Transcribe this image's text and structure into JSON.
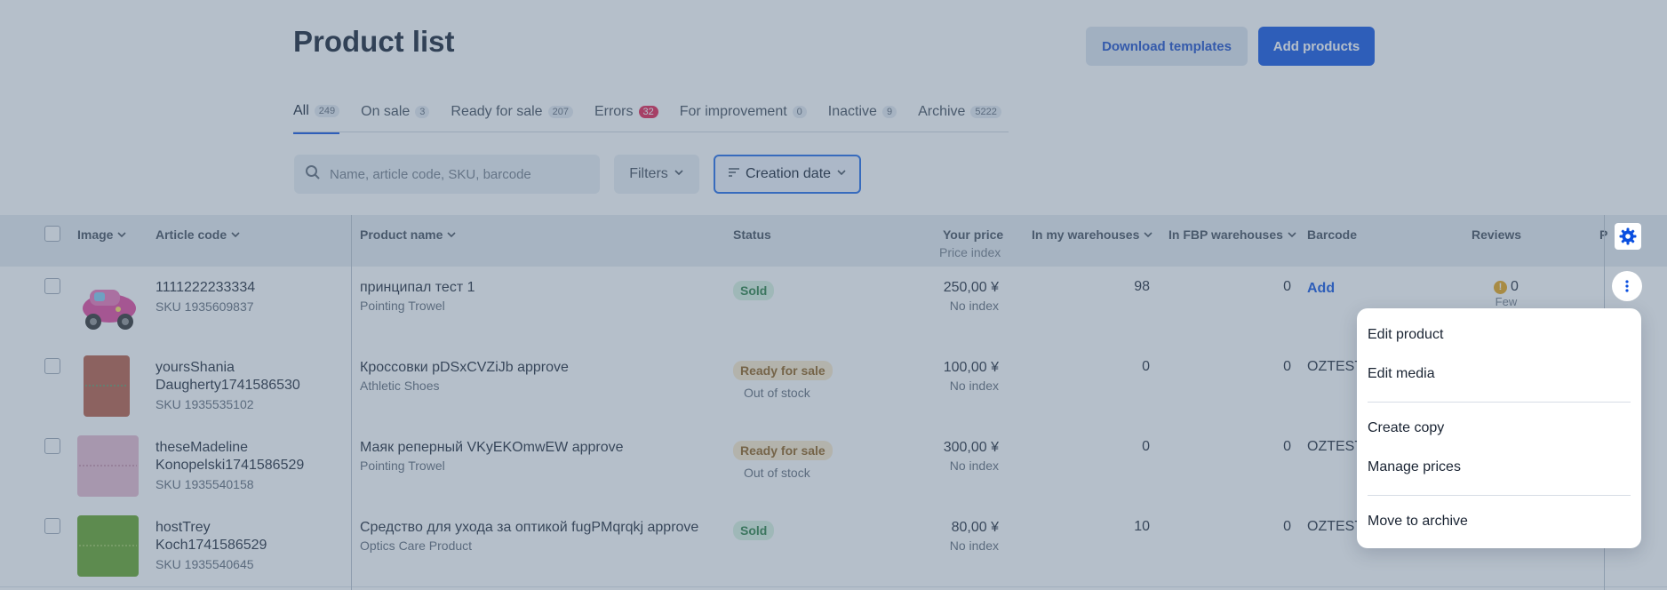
{
  "page": {
    "title": "Product list"
  },
  "buttons": {
    "download_templates": "Download templates",
    "add_products": "Add products"
  },
  "tabs": [
    {
      "label": "All",
      "count": "249"
    },
    {
      "label": "On sale",
      "count": "3"
    },
    {
      "label": "Ready for sale",
      "count": "207"
    },
    {
      "label": "Errors",
      "count": "32"
    },
    {
      "label": "For improvement",
      "count": "0"
    },
    {
      "label": "Inactive",
      "count": "9"
    },
    {
      "label": "Archive",
      "count": "5222"
    }
  ],
  "search": {
    "placeholder": "Name, article code, SKU, barcode",
    "value": ""
  },
  "filters": {
    "label": "Filters"
  },
  "sort": {
    "label": "Creation date"
  },
  "table": {
    "headers": {
      "image": "Image",
      "article_code": "Article code",
      "product_name": "Product name",
      "status": "Status",
      "your_price": "Your price",
      "price_index": "Price index",
      "in_my_warehouses": "In my warehouses",
      "in_fbp_warehouses": "In FBP warehouses",
      "barcode": "Barcode",
      "reviews": "Reviews",
      "cut_off": "P"
    },
    "rows": [
      {
        "article_line1": "1111222233334",
        "article_line2": "",
        "sku": "SKU 1935609837",
        "name": "принципал тест 1",
        "category": "Pointing Trowel",
        "status": "Sold",
        "substatus": "",
        "price": "250,00 ¥",
        "price_index": "No index",
        "my_wh": "98",
        "fbp_wh": "0",
        "barcode": "Add",
        "reviews": "0",
        "reviews_note": "Few"
      },
      {
        "article_line1": "yoursShania",
        "article_line2": "Daugherty1741586530",
        "sku": "SKU 1935535102",
        "name": "Кроссовки pDSxCVZiJb approve",
        "category": "Athletic Shoes",
        "status": "Ready for sale",
        "substatus": "Out of stock",
        "price": "100,00 ¥",
        "price_index": "No index",
        "my_wh": "0",
        "fbp_wh": "0",
        "barcode": "OZTEST"
      },
      {
        "article_line1": "theseMadeline",
        "article_line2": "Konopelski1741586529",
        "sku": "SKU 1935540158",
        "name": "Маяк реперный VKyEKOmwEW approve",
        "category": "Pointing Trowel",
        "status": "Ready for sale",
        "substatus": "Out of stock",
        "price": "300,00 ¥",
        "price_index": "No index",
        "my_wh": "0",
        "fbp_wh": "0",
        "barcode": "OZTEST"
      },
      {
        "article_line1": "hostTrey",
        "article_line2": "Koch1741586529",
        "sku": "SKU 1935540645",
        "name": "Средство для ухода за оптикой fugPMqrqkj approve",
        "category": "Optics Care Product",
        "status": "Sold",
        "substatus": "",
        "price": "80,00 ¥",
        "price_index": "No index",
        "my_wh": "10",
        "fbp_wh": "0",
        "barcode": "OZTEST"
      }
    ]
  },
  "context_menu": {
    "items": [
      "Edit product",
      "Edit media",
      "Create copy",
      "Manage prices",
      "Move to archive"
    ]
  },
  "colors": {
    "accent": "#0a4fe0",
    "error": "#e3194a",
    "sold": "#237a3c",
    "ready": "#8a5a14"
  },
  "icons": {
    "search": "search-icon",
    "settings": "gear-icon",
    "more": "kebab-icon",
    "sort": "sort-icon"
  }
}
